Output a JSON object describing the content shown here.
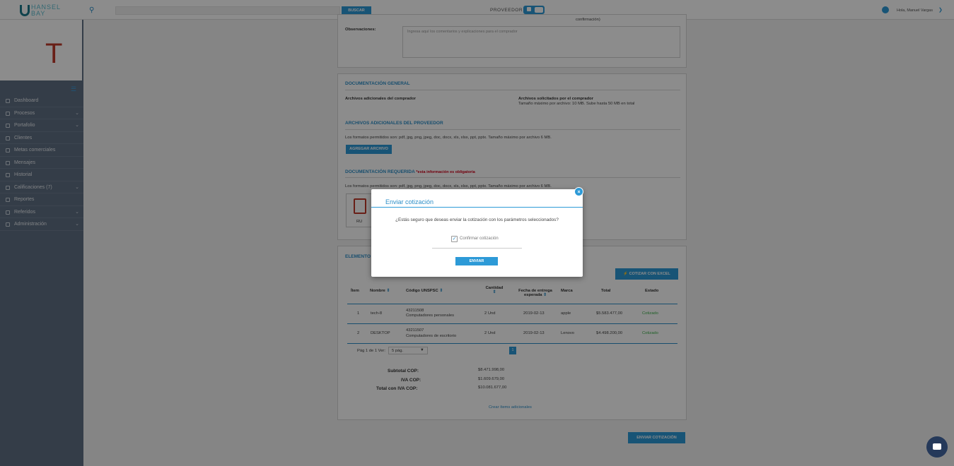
{
  "topbar": {
    "logo_line1": "HANSEL",
    "logo_line2": "BAY",
    "search_button": "BUSCAR",
    "search_placeholder": "",
    "provider_label": "PROVEEDOR",
    "greeting": "Hola, Manuel Vargas"
  },
  "sidebar": {
    "avatar_letter": "T",
    "items": [
      {
        "label": "Dashboard",
        "has_children": false
      },
      {
        "label": "Procesos",
        "has_children": true
      },
      {
        "label": "Portafolio",
        "has_children": true
      },
      {
        "label": "Clientes",
        "has_children": false
      },
      {
        "label": "Metas comerciales",
        "has_children": false
      },
      {
        "label": "Mensajes",
        "has_children": false
      },
      {
        "label": "Historial",
        "has_children": false
      },
      {
        "label": "Calificaciones (7)",
        "has_children": true
      },
      {
        "label": "Reportes",
        "has_children": false
      },
      {
        "label": "Referidos",
        "has_children": true
      },
      {
        "label": "Administración",
        "has_children": true
      }
    ]
  },
  "observations": {
    "top_fragment": "confirmación)",
    "label": "Observaciones:",
    "placeholder": "Ingresa aquí los comentarios y explicaciones para el comprador"
  },
  "docs": {
    "general_title": "DOCUMENTACIÓN GENERAL",
    "buyer_files_label": "Archivos adicionales del comprador",
    "requested_label": "Archivos solicitados por el comprador",
    "requested_note": "Tamaño máximo por archivo: 10 MB. Sube hasta 50 MB en total",
    "provider_title": "ARCHIVOS ADICIONALES DEL PROVEEDOR",
    "formats_note": "Los formatos permitidos son: pdf, jpg, png, jpeg, doc, docx, xls, xlsx, ppt, pptx. Tamaño máximo por archivo 6 MB.",
    "add_button": "AGREGAR ARCHIVO",
    "required_title": "DOCUMENTACIÓN REQUERIDA",
    "required_note": "*esta información es obligatoria",
    "required_formats": "Los formatos permitidos son: pdf, jpg, png, jpeg, doc, docx, xls, xlsx, ppt, pptx. Tamaño máximo por archivo 6 MB.",
    "file_caption": "RU"
  },
  "elements": {
    "title": "ELEMENTO",
    "excel_button": "⚡ COTIZAR CON EXCEL",
    "columns": [
      "Ítem",
      "Nombre",
      "Código UNSPSC",
      "Cantidad",
      "Fecha de entrega esperada",
      "Marca",
      "Total",
      "Estado"
    ],
    "rows": [
      {
        "item": "1",
        "name": "tech-8",
        "code": "43211508",
        "code_desc": "Computadores personales",
        "qty": "2 Und",
        "date": "2019-02-13",
        "brand": "apple",
        "total": "$5.583.477,00",
        "status": "Cotizado"
      },
      {
        "item": "2",
        "name": "DESKTOP",
        "code": "43211507",
        "code_desc": "Computadores de escritorio",
        "qty": "2 Und",
        "date": "2019-02-13",
        "brand": "Lenovo",
        "total": "$4.498.200,00",
        "status": "Cotizado"
      }
    ],
    "pager_text": "Pág 1 de 1 Ver:",
    "pager_select": "5 pág.",
    "page_number": "1",
    "subtotal_label": "Subtotal COP:",
    "subtotal_value": "$8.471.998,00",
    "iva_label": "IVA COP:",
    "iva_value": "$1.609.679,00",
    "total_label": "Total con IVA COP:",
    "total_value": "$10.081.677,00",
    "create_items_link": "Crear ítems adicionales"
  },
  "send_quote_button": "ENVIAR COTIZACIÓN",
  "modal": {
    "title": "Enviar cotización",
    "question": "¿Estás seguro que deseas enviar la cotización con los parámetros seleccionados?",
    "checkbox_label": "Confirmar cotización",
    "checked": true,
    "send_button": "ENVIAR",
    "close": "×"
  },
  "colors": {
    "accent": "#2d9ad7",
    "sidebar": "#5f6f84",
    "status_ok": "#3cb04a",
    "required_red": "#d0021b"
  },
  "icons": [
    "search-icon",
    "user-icon",
    "menu-list-icon",
    "close-icon",
    "chat-icon",
    "check-icon",
    "pdf-file-icon"
  ]
}
